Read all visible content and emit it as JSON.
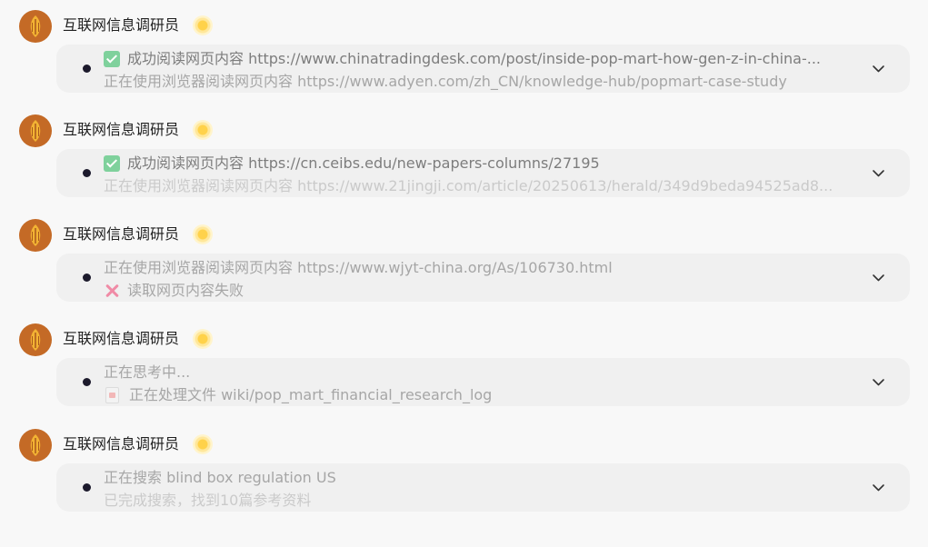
{
  "entries": [
    {
      "agent_name": "互联网信息调研员",
      "line1": {
        "icon": "check-icon",
        "text": "成功阅读网页内容 https://www.chinatradingdesk.com/post/inside-pop-mart-how-gen-z-in-china-..."
      },
      "line2": {
        "icon": "",
        "text": "正在使用浏览器阅读网页内容 https://www.adyen.com/zh_CN/knowledge-hub/popmart-case-study"
      }
    },
    {
      "agent_name": "互联网信息调研员",
      "line1": {
        "icon": "check-icon",
        "text": "成功阅读网页内容 https://cn.ceibs.edu/new-papers-columns/27195"
      },
      "line2": {
        "icon": "",
        "text": "正在使用浏览器阅读网页内容 https://www.21jingji.com/article/20250613/herald/349d9beda94525ad8..."
      }
    },
    {
      "agent_name": "互联网信息调研员",
      "line1": {
        "icon": "",
        "text": "正在使用浏览器阅读网页内容 https://www.wjyt-china.org/As/106730.html"
      },
      "line2": {
        "icon": "cross-icon",
        "text": "读取网页内容失败"
      }
    },
    {
      "agent_name": "互联网信息调研员",
      "line1": {
        "icon": "",
        "text": "正在思考中..."
      },
      "line2": {
        "icon": "file-icon",
        "text": "正在处理文件 wiki/pop_mart_financial_research_log"
      }
    },
    {
      "agent_name": "互联网信息调研员",
      "line1": {
        "icon": "",
        "text": "正在搜索 blind box regulation US"
      },
      "line2": {
        "icon": "",
        "text": "已完成搜索，找到10篇参考资料"
      }
    }
  ],
  "colors": {
    "avatar": "#c46a26",
    "status_dot": "#ffd24a",
    "check": "#7fd19c",
    "cross": "#f08ba6",
    "card_bg": "#f0f0f0"
  }
}
